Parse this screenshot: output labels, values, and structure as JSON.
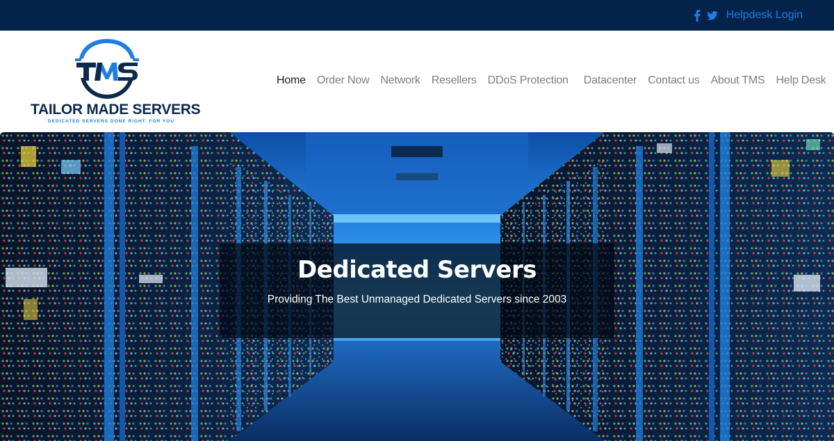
{
  "topbar": {
    "social": [
      {
        "name": "facebook-icon",
        "glyph": "f"
      },
      {
        "name": "twitter-icon",
        "glyph": "twitter"
      }
    ],
    "helpdesk_login": "Helpdesk Login",
    "colors": {
      "background": "#03234a",
      "link": "#1e7ee6"
    }
  },
  "logo": {
    "monogram": "TMS",
    "name": "TAILOR MADE SERVERS",
    "tagline": "DEDICATED SERVERS DONE RIGHT. FOR YOU",
    "colors": {
      "navy": "#0c2a4d",
      "blue": "#1e7ee6"
    }
  },
  "nav": {
    "items": [
      {
        "label": "Home",
        "active": true
      },
      {
        "label": "Order Now",
        "active": false
      },
      {
        "label": "Network",
        "active": false
      },
      {
        "label": "Resellers",
        "active": false
      },
      {
        "label": "DDoS Protection",
        "active": false
      },
      {
        "label": "Datacenter",
        "active": false
      },
      {
        "label": "Contact us",
        "active": false
      },
      {
        "label": "About TMS",
        "active": false
      },
      {
        "label": "Help Desk",
        "active": false
      }
    ]
  },
  "hero": {
    "title": "Dedicated Servers",
    "subtitle": "Providing The Best Unmanaged Dedicated Servers since 2003",
    "image_description": "server-room-corridor"
  }
}
